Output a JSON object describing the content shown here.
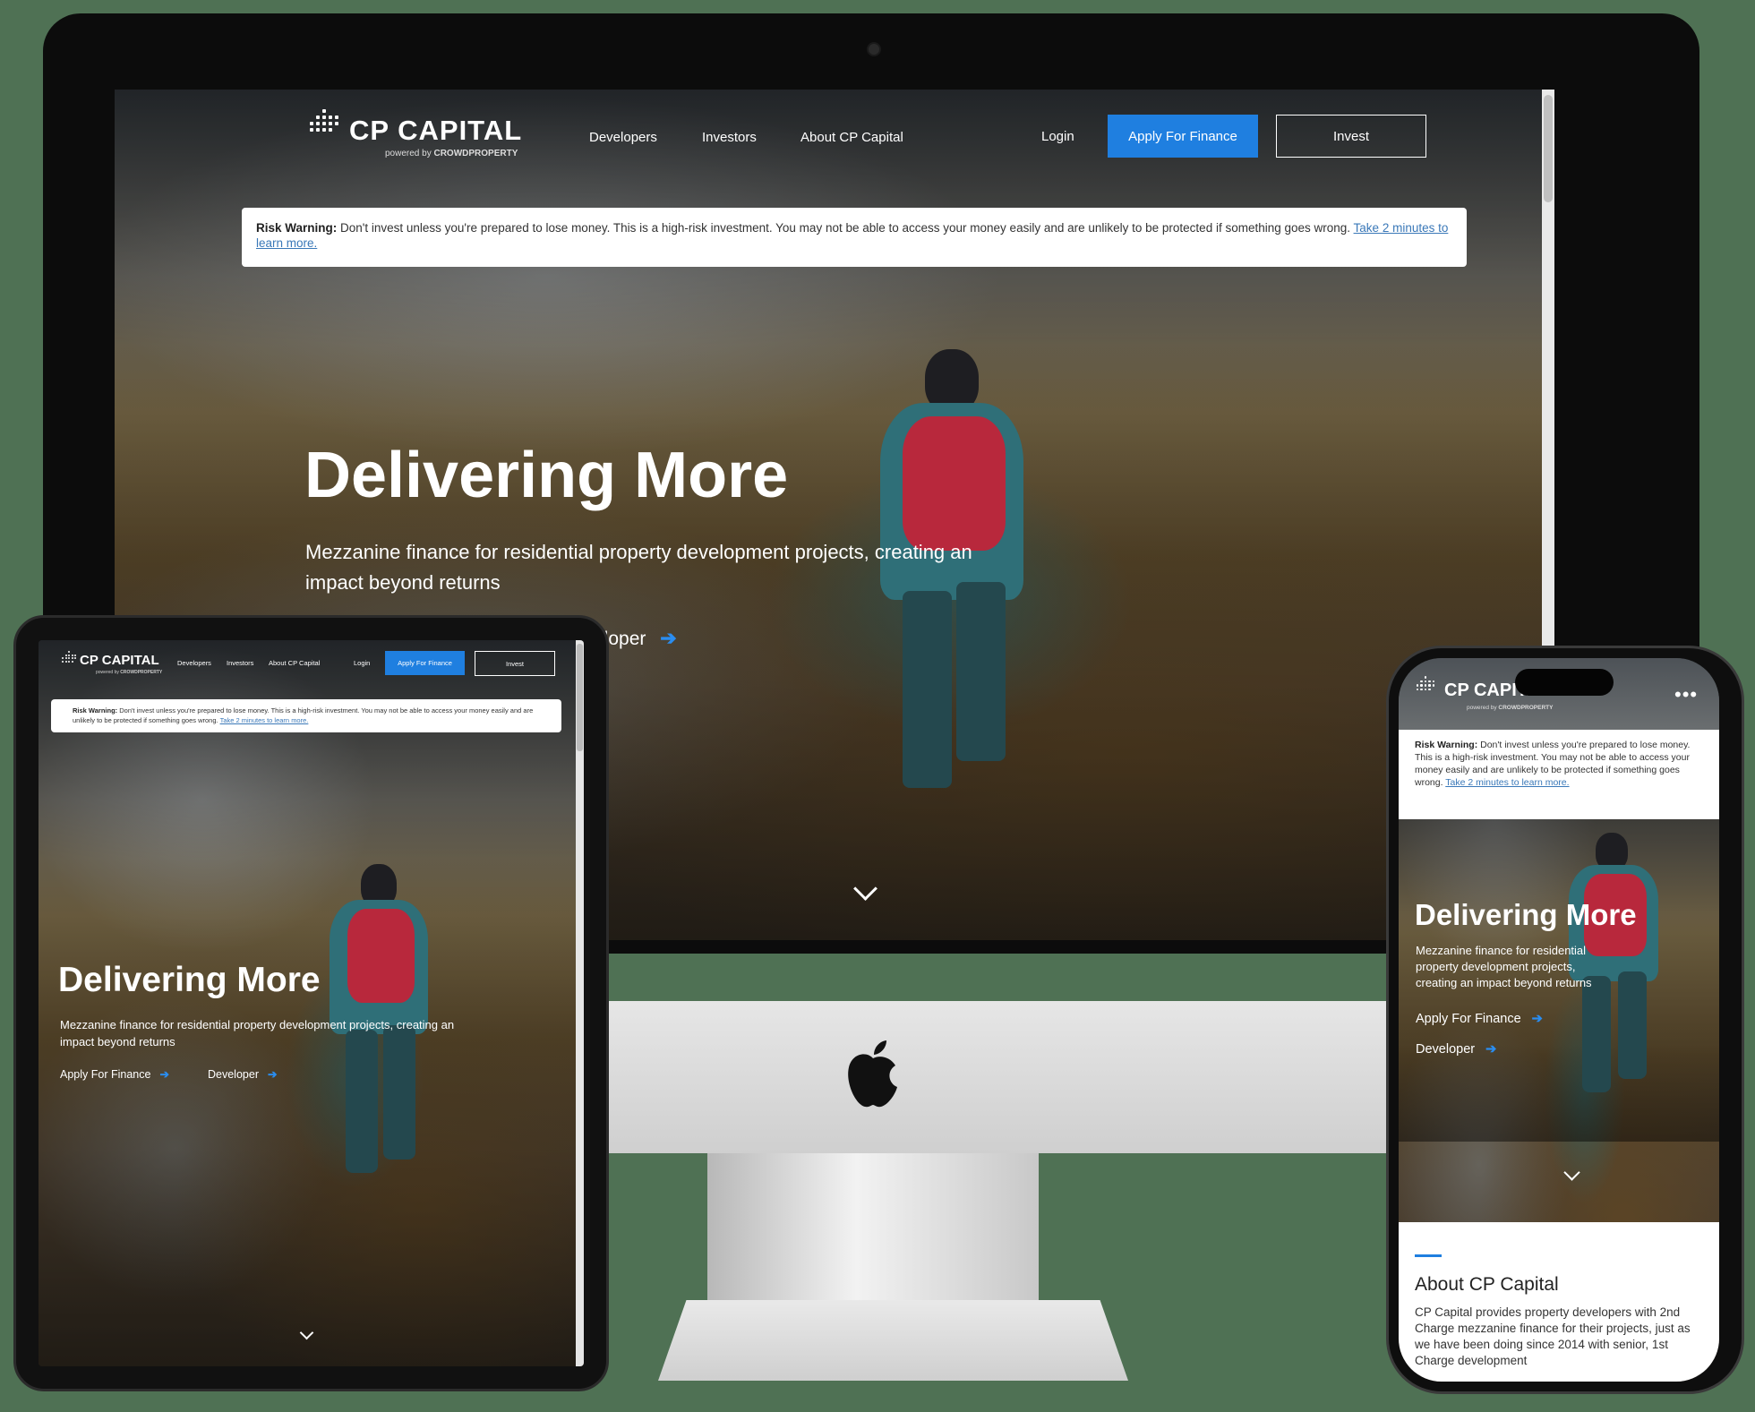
{
  "brand": {
    "name": "CP CAPITAL",
    "powered_prefix": "powered by ",
    "powered_brand": "CROWDPROPERTY"
  },
  "nav": {
    "developers": "Developers",
    "investors": "Investors",
    "about": "About CP Capital",
    "login": "Login",
    "apply": "Apply For Finance",
    "invest": "Invest"
  },
  "risk": {
    "label": "Risk Warning:",
    "text": " Don't invest unless you're prepared to lose money. This is a high-risk investment. You may not be able to access your money easily and are unlikely to be protected if something goes wrong.",
    "link": "Take 2 minutes to learn more."
  },
  "hero": {
    "title": "Delivering More",
    "subtitle": "Mezzanine finance for residential property development projects, creating an impact beyond returns",
    "cta_finance": "Apply For Finance",
    "cta_developer": "Developer",
    "desktop_cta_visible": "eloper"
  },
  "about": {
    "title": "About CP Capital",
    "body": "CP Capital provides property developers with 2nd Charge mezzanine finance for their projects, just as we have been doing since 2014 with senior, 1st Charge development"
  },
  "icons": {
    "arrow": "arrow-right-icon",
    "chevron": "chevron-down-icon",
    "menu": "more-dots-icon",
    "apple": "apple-logo-icon"
  },
  "colors": {
    "accent": "#1f7fe0",
    "backdrop": "#4f7154"
  }
}
